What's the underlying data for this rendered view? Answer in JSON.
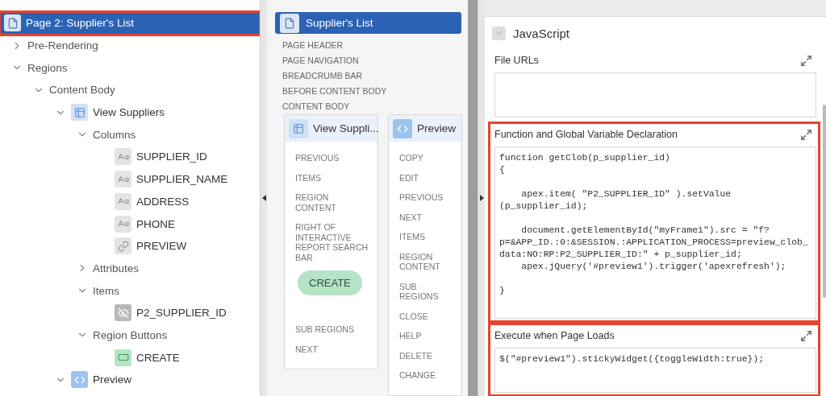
{
  "tree": [
    {
      "label": "Page 2: Supplier's List",
      "kind": "page",
      "selected": true,
      "highlighted": true
    },
    {
      "label": "Pre-Rendering",
      "expanded": false,
      "selected": false
    },
    {
      "label": "Regions",
      "expanded": true,
      "selected": false,
      "children": [
        {
          "label": "Content Body",
          "expanded": true,
          "selected": false,
          "children": [
            {
              "label": "View Suppliers",
              "kind": "region",
              "expanded": true,
              "selected": false,
              "children": [
                {
                  "label": "Columns",
                  "expanded": true,
                  "selected": false,
                  "children": [
                    {
                      "label": "SUPPLIER_ID",
                      "kind": "column",
                      "selected": false
                    },
                    {
                      "label": "SUPPLIER_NAME",
                      "kind": "column",
                      "selected": false
                    },
                    {
                      "label": "ADDRESS",
                      "kind": "column",
                      "selected": false
                    },
                    {
                      "label": "PHONE",
                      "kind": "column",
                      "selected": false
                    },
                    {
                      "label": "PREVIEW",
                      "kind": "link",
                      "selected": false
                    }
                  ]
                },
                {
                  "label": "Attributes",
                  "expanded": false,
                  "selected": false
                },
                {
                  "label": "Items",
                  "expanded": true,
                  "selected": false,
                  "children": [
                    {
                      "label": "P2_SUPPLIER_ID",
                      "kind": "hidden",
                      "selected": false
                    }
                  ]
                },
                {
                  "label": "Region Buttons",
                  "expanded": true,
                  "selected": false,
                  "children": [
                    {
                      "label": "CREATE",
                      "kind": "button",
                      "selected": false
                    }
                  ]
                }
              ]
            },
            {
              "label": "Preview",
              "kind": "code",
              "expanded": true,
              "selected": false
            }
          ]
        }
      ]
    }
  ],
  "layout": {
    "title": "Supplier's List",
    "positions": [
      "PAGE HEADER",
      "PAGE NAVIGATION",
      "BREADCRUMB BAR",
      "BEFORE CONTENT BODY",
      "CONTENT BODY"
    ],
    "regions": [
      {
        "title": "View Suppli...",
        "kind": "region",
        "slots": [
          {
            "kind": "position",
            "label": "PREVIOUS"
          },
          {
            "kind": "position",
            "label": "ITEMS"
          },
          {
            "kind": "position",
            "label": "REGION CONTENT"
          },
          {
            "kind": "position",
            "label": "RIGHT OF INTERACTIVE REPORT SEARCH BAR"
          },
          {
            "kind": "button",
            "label": "CREATE"
          },
          {
            "kind": "position",
            "label": "SUB REGIONS"
          },
          {
            "kind": "position",
            "label": "NEXT"
          }
        ]
      },
      {
        "title": "Preview",
        "kind": "code",
        "slots": [
          {
            "kind": "position",
            "label": "COPY"
          },
          {
            "kind": "position",
            "label": "EDIT"
          },
          {
            "kind": "position",
            "label": "PREVIOUS"
          },
          {
            "kind": "position",
            "label": "NEXT"
          },
          {
            "kind": "position",
            "label": "ITEMS"
          },
          {
            "kind": "position",
            "label": "REGION CONTENT"
          },
          {
            "kind": "position",
            "label": "SUB REGIONS"
          },
          {
            "kind": "position",
            "label": "CLOSE"
          },
          {
            "kind": "position",
            "label": "HELP"
          },
          {
            "kind": "position",
            "label": "DELETE"
          },
          {
            "kind": "position",
            "label": "CHANGE"
          }
        ]
      }
    ]
  },
  "properties": {
    "section": {
      "title": "JavaScript",
      "expanded": true
    },
    "fields": [
      {
        "label": "File URLs"
      },
      {
        "label": "Function and Global Variable Declaration",
        "highlighted": true,
        "value": "function getClob(p_supplier_id)\n{\n\n    apex.item( \"P2_SUPPLIER_ID\" ).setValue\n(p_supplier_id);\n\n    document.getElementById(\"myFrame1\").src = \"f?\np=&APP_ID.:0:&SESSION.:APPLICATION_PROCESS=preview_clob_\ndata:NO:RP:P2_SUPPLIER_ID:\" + p_supplier_id;\n    apex.jQuery('#preview1').trigger('apexrefresh');\n\n}"
      },
      {
        "label": "Execute when Page Loads",
        "highlighted": true,
        "value": "$(\"#preview1\").stickyWidget({toggleWidth:true});"
      }
    ]
  }
}
